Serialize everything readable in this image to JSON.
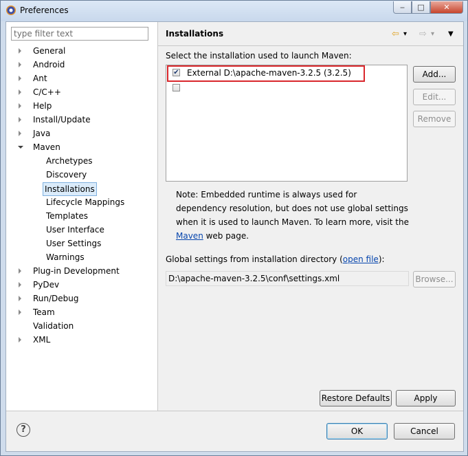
{
  "window": {
    "title": "Preferences",
    "minimize_glyph": "‒",
    "maximize_glyph": "□",
    "close_glyph": "✕"
  },
  "filter": {
    "placeholder": "type filter text"
  },
  "tree": [
    {
      "label": "General",
      "state": "collapsed",
      "level": 0
    },
    {
      "label": "Android",
      "state": "collapsed",
      "level": 0
    },
    {
      "label": "Ant",
      "state": "collapsed",
      "level": 0
    },
    {
      "label": "C/C++",
      "state": "collapsed",
      "level": 0
    },
    {
      "label": "Help",
      "state": "collapsed",
      "level": 0
    },
    {
      "label": "Install/Update",
      "state": "collapsed",
      "level": 0
    },
    {
      "label": "Java",
      "state": "collapsed",
      "level": 0
    },
    {
      "label": "Maven",
      "state": "expanded",
      "level": 0
    },
    {
      "label": "Archetypes",
      "state": "leaf",
      "level": 1
    },
    {
      "label": "Discovery",
      "state": "leaf",
      "level": 1
    },
    {
      "label": "Installations",
      "state": "leaf",
      "level": 1,
      "selected": true
    },
    {
      "label": "Lifecycle Mappings",
      "state": "leaf",
      "level": 1
    },
    {
      "label": "Templates",
      "state": "leaf",
      "level": 1
    },
    {
      "label": "User Interface",
      "state": "leaf",
      "level": 1
    },
    {
      "label": "User Settings",
      "state": "leaf",
      "level": 1
    },
    {
      "label": "Warnings",
      "state": "leaf",
      "level": 1
    },
    {
      "label": "Plug-in Development",
      "state": "collapsed",
      "level": 0
    },
    {
      "label": "PyDev",
      "state": "collapsed",
      "level": 0
    },
    {
      "label": "Run/Debug",
      "state": "collapsed",
      "level": 0
    },
    {
      "label": "Team",
      "state": "collapsed",
      "level": 0
    },
    {
      "label": "Validation",
      "state": "leaf",
      "level": 0
    },
    {
      "label": "XML",
      "state": "collapsed",
      "level": 0
    }
  ],
  "page": {
    "title": "Installations",
    "select_label": "Select the installation used to launch Maven:",
    "installations": [
      {
        "label": "External D:\\apache-maven-3.2.5 (3.2.5)",
        "checked": true
      },
      {
        "label": "",
        "checked": false
      }
    ],
    "buttons": {
      "add": "Add...",
      "edit": "Edit...",
      "remove": "Remove"
    },
    "note_text": "Note: Embedded runtime is always used for dependency resolution, but does not use global settings when it is used to launch Maven. To learn more, visit the ",
    "note_link": "Maven",
    "note_suffix": " web page.",
    "global_label_prefix": "Global settings from installation directory (",
    "global_link": "open file",
    "global_label_suffix": "):",
    "global_settings_path": "D:\\apache-maven-3.2.5\\conf\\settings.xml",
    "browse_button": "Browse...",
    "restore_defaults": "Restore Defaults",
    "apply": "Apply"
  },
  "footer": {
    "help_glyph": "?",
    "ok": "OK",
    "cancel": "Cancel"
  },
  "nav": {
    "back_glyph": "⇦",
    "forward_glyph": "⇨",
    "dropdown_glyph": "▾",
    "menu_glyph": "▼"
  },
  "colors": {
    "highlight_box": "#d9262b",
    "link": "#0645ad",
    "selection": "#dbecfb"
  }
}
